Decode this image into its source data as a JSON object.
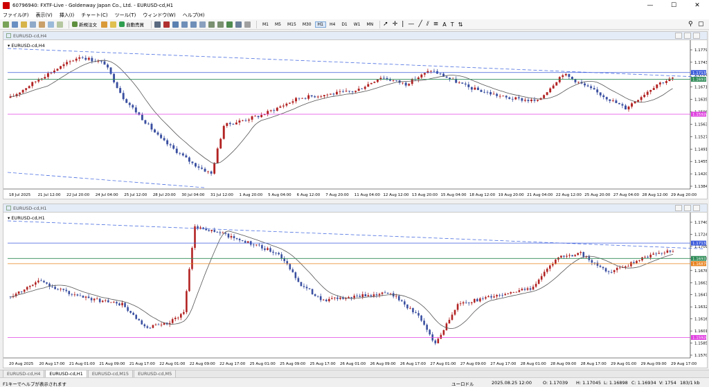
{
  "window": {
    "title": "60796940: FXTF-Live - Goldenway Japan Co., Ltd. - EURUSD-cd,H1",
    "minimize": "—",
    "maximize": "☐",
    "close": "✕"
  },
  "menu": [
    "ファイル(F)",
    "表示(V)",
    "挿入(I)",
    "チャート(C)",
    "ツール(T)",
    "ウィンドウ(W)",
    "ヘルプ(H)"
  ],
  "toolbar": {
    "new_order": "新規注文",
    "auto_trade": "自動売買",
    "timeframes": [
      "M1",
      "M5",
      "M15",
      "M30",
      "H1",
      "H4",
      "D1",
      "W1",
      "MN"
    ],
    "active_timeframe": "H1"
  },
  "charts": [
    {
      "window_title": "EURUSD-cd,H4",
      "symbol_label": "EURUSD-cd,H4",
      "price_labels": [
        "1.17790",
        "1.17430",
        "1.17070",
        "1.16710",
        "1.16350",
        "1.15990",
        "1.15630",
        "1.15270",
        "1.14910",
        "1.14550",
        "1.14200",
        "1.13840"
      ],
      "highlight_labels": [
        {
          "text": "1.17133",
          "color": "#3b5bdb",
          "price": 1.17133
        },
        {
          "text": "1.16937",
          "color": "#2e8b57",
          "price": 1.16937
        },
        {
          "text": "1.15926",
          "color": "#e040e0",
          "price": 1.15926
        }
      ],
      "time_labels": [
        "18 Jul 2025",
        "21 Jul 12:00",
        "22 Jul 20:00",
        "24 Jul 04:00",
        "25 Jul 12:00",
        "28 Jul 20:00",
        "30 Jul 04:00",
        "31 Jul 12:00",
        "1 Aug 20:00",
        "5 Aug 04:00",
        "6 Aug 12:00",
        "7 Aug 20:00",
        "11 Aug 04:00",
        "12 Aug 12:00",
        "13 Aug 20:00",
        "15 Aug 04:00",
        "18 Aug 12:00",
        "19 Aug 20:00",
        "21 Aug 04:00",
        "22 Aug 12:00",
        "25 Aug 20:00",
        "27 Aug 04:00",
        "28 Aug 12:00",
        "29 Aug 20:00"
      ]
    },
    {
      "window_title": "EURUSD-cd,H1",
      "symbol_label": "EURUSD-cd,H1",
      "price_labels": [
        "1.17400",
        "1.17245",
        "1.17090",
        "1.16940",
        "1.16785",
        "1.16630",
        "1.16475",
        "1.16320",
        "1.16165",
        "1.16010",
        "1.15855",
        "1.15700"
      ],
      "highlight_labels": [
        {
          "text": "1.17133",
          "color": "#3b5bdb",
          "price": 1.17133
        },
        {
          "text": "1.16937",
          "color": "#2e8b57",
          "price": 1.16937
        },
        {
          "text": "1.16870",
          "color": "#e8821e",
          "price": 1.1687
        },
        {
          "text": "1.15926",
          "color": "#e040e0",
          "price": 1.15926
        }
      ],
      "time_labels": [
        "20 Aug 2025",
        "20 Aug 17:00",
        "21 Aug 01:00",
        "21 Aug 09:00",
        "21 Aug 17:00",
        "22 Aug 01:00",
        "22 Aug 09:00",
        "22 Aug 17:00",
        "25 Aug 01:00",
        "25 Aug 09:00",
        "25 Aug 17:00",
        "26 Aug 01:00",
        "26 Aug 09:00",
        "26 Aug 17:00",
        "27 Aug 01:00",
        "27 Aug 09:00",
        "27 Aug 17:00",
        "28 Aug 01:00",
        "28 Aug 09:00",
        "28 Aug 17:00",
        "29 Aug 01:00",
        "29 Aug 09:00",
        "29 Aug 17:00"
      ]
    }
  ],
  "tabs": [
    "EURUSD-cd,H4",
    "EURUSD-cd,H1",
    "EURUSD-cd,M15",
    "EURUSD-cd,M5"
  ],
  "active_tab": "EURUSD-cd,H1",
  "status": {
    "help": "F1キーでヘルプが表示されます",
    "profile": "ユーロドル",
    "datetime": "2025.08.25 12:00",
    "open": "O: 1.17039",
    "high": "H: 1.17045",
    "low": "L: 1.16898",
    "close": "C: 1.16934",
    "volume": "V: 1754",
    "traffic": "183/1 kb"
  },
  "colors": {
    "bull": "#b22222",
    "bear": "#3a4fa0",
    "ma": "#555555",
    "trend": "#4a6ee0",
    "orange": "#e8821e"
  }
}
